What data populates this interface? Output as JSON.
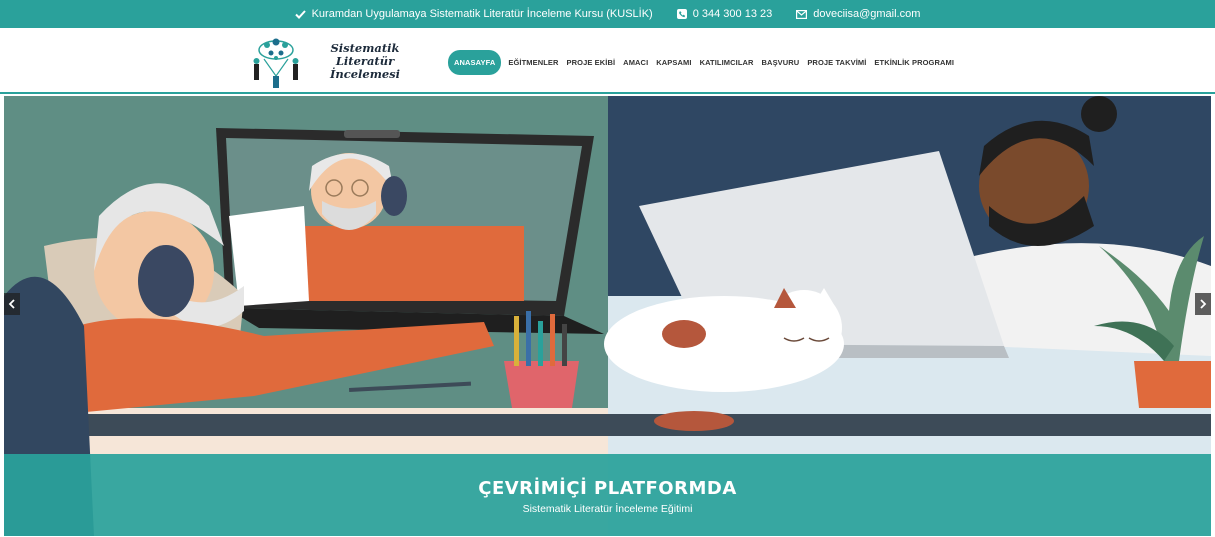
{
  "topbar": {
    "course": "Kuramdan Uygulamaya Sistematik Literatür İnceleme Kursu (KUSLİK)",
    "phone": "0 344 300 13 23",
    "email": "doveciisa@gmail.com",
    "icons": [
      "check-icon",
      "phone-icon",
      "envelope-icon"
    ]
  },
  "logo": {
    "line1": "Sistematik Literatür",
    "line2": "İncelemesi"
  },
  "nav": {
    "items": [
      "ANASAYFA",
      "EĞİTMENLER",
      "PROJE EKİBİ",
      "AMACI",
      "KAPSAMI",
      "KATILIMCILAR",
      "BAŞVURU",
      "PROJE TAKVİMİ",
      "ETKİNLİK PROGRAMI"
    ],
    "active": "ANASAYFA"
  },
  "slider": {
    "title": "ÇEVRİMİÇİ PLATFORMDA",
    "subtitle": "Sistematik Literatür İnceleme Eğitimi",
    "prev_icon": "chevron-left-icon",
    "next_icon": "chevron-right-icon"
  },
  "colors": {
    "accent": "#2aa19b",
    "hero_left_bg": "#5f8e84",
    "hero_right_bg": "#2f4763",
    "orange": "#e06a3c"
  }
}
